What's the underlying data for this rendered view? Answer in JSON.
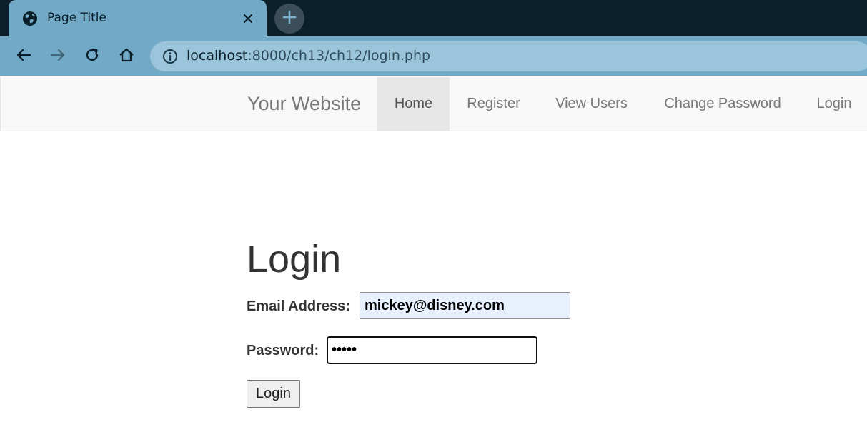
{
  "browser": {
    "tab": {
      "title": "Page Title",
      "favicon": "globe-icon",
      "close_icon": "close-icon"
    },
    "new_tab_icon": "plus-icon",
    "toolbar": {
      "back_icon": "arrow-left-icon",
      "forward_icon": "arrow-right-icon",
      "reload_icon": "reload-icon",
      "home_icon": "home-icon",
      "site_info_icon": "info-icon"
    },
    "address": {
      "host": "localhost",
      "path": ":8000/ch13/ch12/login.php"
    }
  },
  "navbar": {
    "brand": "Your Website",
    "items": [
      {
        "label": "Home",
        "active": true
      },
      {
        "label": "Register",
        "active": false
      },
      {
        "label": "View Users",
        "active": false
      },
      {
        "label": "Change Password",
        "active": false
      },
      {
        "label": "Login",
        "active": false
      }
    ]
  },
  "form": {
    "heading": "Login",
    "email_label": "Email Address:",
    "email_value": "mickey@disney.com",
    "password_label": "Password:",
    "password_value": "•••••",
    "submit_label": "Login"
  },
  "colors": {
    "tab_active": "#71a9c6",
    "tabstrip_bg": "#0b1f2b",
    "omnibox_bg": "#9ac5da",
    "navbar_bg": "#f8f8f8",
    "nav_active_bg": "#e7e7e7",
    "autofill_bg": "#e8f0fe"
  }
}
